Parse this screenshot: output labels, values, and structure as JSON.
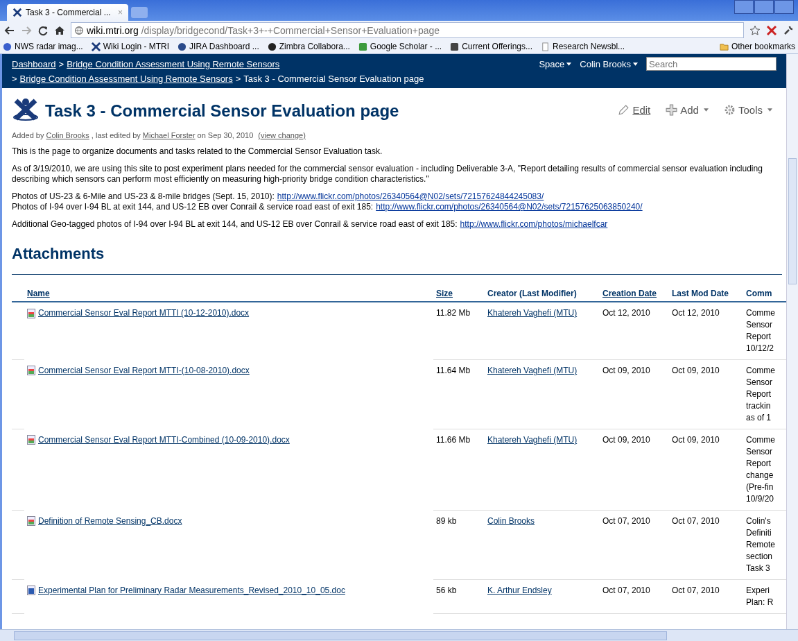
{
  "browser": {
    "tab": {
      "title": "Task 3 - Commercial ...",
      "close": "×"
    },
    "url": {
      "host": "wiki.mtri.org",
      "path": "/display/bridgecond/Task+3+-+Commercial+Sensor+Evaluation+page"
    },
    "bookmarks": [
      {
        "kind": "shield",
        "label": "NWS radar imag..."
      },
      {
        "kind": "logo",
        "label": "Wiki Login - MTRI"
      },
      {
        "kind": "person",
        "label": "JIRA Dashboard ..."
      },
      {
        "kind": "bird",
        "label": "Zimbra Collabora..."
      },
      {
        "kind": "puzzle",
        "label": "Google Scholar - ..."
      },
      {
        "kind": "badge",
        "label": "Current Offerings..."
      },
      {
        "kind": "page",
        "label": "Research Newsbl..."
      }
    ],
    "other_bookmarks": "Other bookmarks"
  },
  "header": {
    "breadcrumb_top": [
      "Dashboard",
      "Bridge Condition Assessment Using Remote Sensors"
    ],
    "separator": ">",
    "menus": [
      "Space",
      "Colin Brooks"
    ],
    "search": {
      "placeholder": "Search"
    },
    "breadcrumb_bottom": [
      "Bridge Condition Assessment Using Remote Sensors",
      "Task 3 - Commercial Sensor Evaluation page"
    ]
  },
  "page": {
    "title": "Task 3 - Commercial Sensor Evaluation page",
    "actions": [
      "Edit",
      "Add",
      "Tools"
    ],
    "byline": {
      "added_by": "Added by",
      "author": "Colin Brooks",
      "edited": ", last edited by",
      "editor": "Michael Forster",
      "date": "on Sep 30, 2010",
      "view_change": "(view change)"
    },
    "intro": "This is the page to organize documents and tasks related to the Commercial Sensor Evaluation task.",
    "paragraph": "As of 3/19/2010, we are using this site to post experiment plans needed for the commercial sensor evaluation - including Deliverable 3-A, \"Report detailing results of commercial sensor evaluation including describing which sensors can perform most efficiently on measuring high-priority bridge condition characteristics.\"",
    "photo_lines": [
      {
        "text": "Photos of US-23 & 6-Mile and US-23 & 8-mile bridges (Sept. 15, 2010):",
        "link": "http://www.flickr.com/photos/26340564@N02/sets/72157624844245083/"
      },
      {
        "text": "Photos of I-94 over I-94 BL at exit 144, and US-12 EB over Conrail & service road east of exit 185:",
        "link": "http://www.flickr.com/photos/26340564@N02/sets/72157625063850240/"
      }
    ],
    "geo_line": {
      "text": "Additional Geo-tagged photos of I-94 over I-94 BL at exit 144, and US-12 EB over Conrail & service road east of exit 185:",
      "link": "http://www.flickr.com/photos/michaelfcar"
    }
  },
  "attachments": {
    "heading": "Attachments",
    "columns": [
      "Name",
      "Size",
      "Creator (Last Modifier)",
      "Creation Date",
      "Last Mod Date",
      "Comm"
    ],
    "rows": [
      {
        "kind": "docx",
        "name": "Commercial Sensor Eval Report MTTI (10-12-2010).docx",
        "size": "11.82 Mb",
        "creator": "Khatereh Vaghefi (MTU)",
        "created": "Oct 12, 2010",
        "modified": "Oct 12, 2010",
        "comment": [
          "Comme",
          "Sensor",
          "Report",
          "10/12/2"
        ]
      },
      {
        "kind": "docx",
        "name": "Commercial Sensor Eval Report MTTI-(10-08-2010).docx",
        "size": "11.64 Mb",
        "creator": "Khatereh Vaghefi (MTU)",
        "created": "Oct 09, 2010",
        "modified": "Oct 09, 2010",
        "comment": [
          "Comme",
          "Sensor",
          "Report",
          "trackin",
          "as of 1"
        ]
      },
      {
        "kind": "docx",
        "name": "Commercial Sensor Eval Report MTTI-Combined (10-09-2010).docx",
        "size": "11.66 Mb",
        "creator": "Khatereh Vaghefi (MTU)",
        "created": "Oct 09, 2010",
        "modified": "Oct 09, 2010",
        "comment": [
          "Comme",
          "Sensor",
          "Report",
          "change",
          "(Pre-fin",
          "10/9/20"
        ]
      },
      {
        "kind": "docx",
        "name": "Definition of Remote Sensing_CB.docx",
        "size": "89 kb",
        "creator": "Colin Brooks",
        "created": "Oct 07, 2010",
        "modified": "Oct 07, 2010",
        "comment": [
          "Colin's",
          "Definiti",
          "Remote",
          "section",
          "Task 3"
        ]
      },
      {
        "kind": "doc",
        "name": "Experimental Plan for Preliminary Radar Measurements_Revised_2010_10_05.doc",
        "size": "56 kb",
        "creator": "K. Arthur Endsley",
        "created": "Oct 07, 2010",
        "modified": "Oct 07, 2010",
        "comment": [
          "Experi",
          "Plan: R"
        ]
      }
    ]
  }
}
